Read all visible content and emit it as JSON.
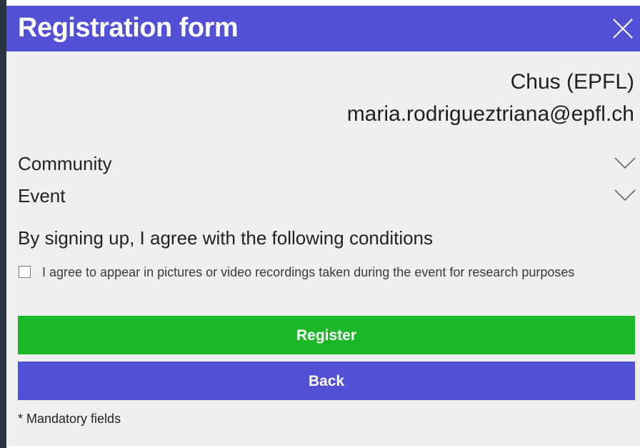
{
  "modal": {
    "title": "Registration form",
    "close_icon": "close-icon",
    "accent_color": "#5250d4"
  },
  "user": {
    "name": "Chus (EPFL)",
    "email": "maria.rodrigueztriana@epfl.ch"
  },
  "fields": {
    "community": {
      "label": "Community",
      "icon": "chevron-down-icon"
    },
    "event": {
      "label": "Event",
      "icon": "chevron-down-icon"
    }
  },
  "conditions": {
    "heading": "By signing up, I agree with the following conditions",
    "consent_checked": false,
    "consent_text": "I agree to appear in pictures or video recordings taken during the event for research purposes"
  },
  "buttons": {
    "register_label": "Register",
    "register_color": "#1db82a",
    "back_label": "Back",
    "back_color": "#5250d4"
  },
  "footer": {
    "mandatory_note": "* Mandatory fields"
  }
}
